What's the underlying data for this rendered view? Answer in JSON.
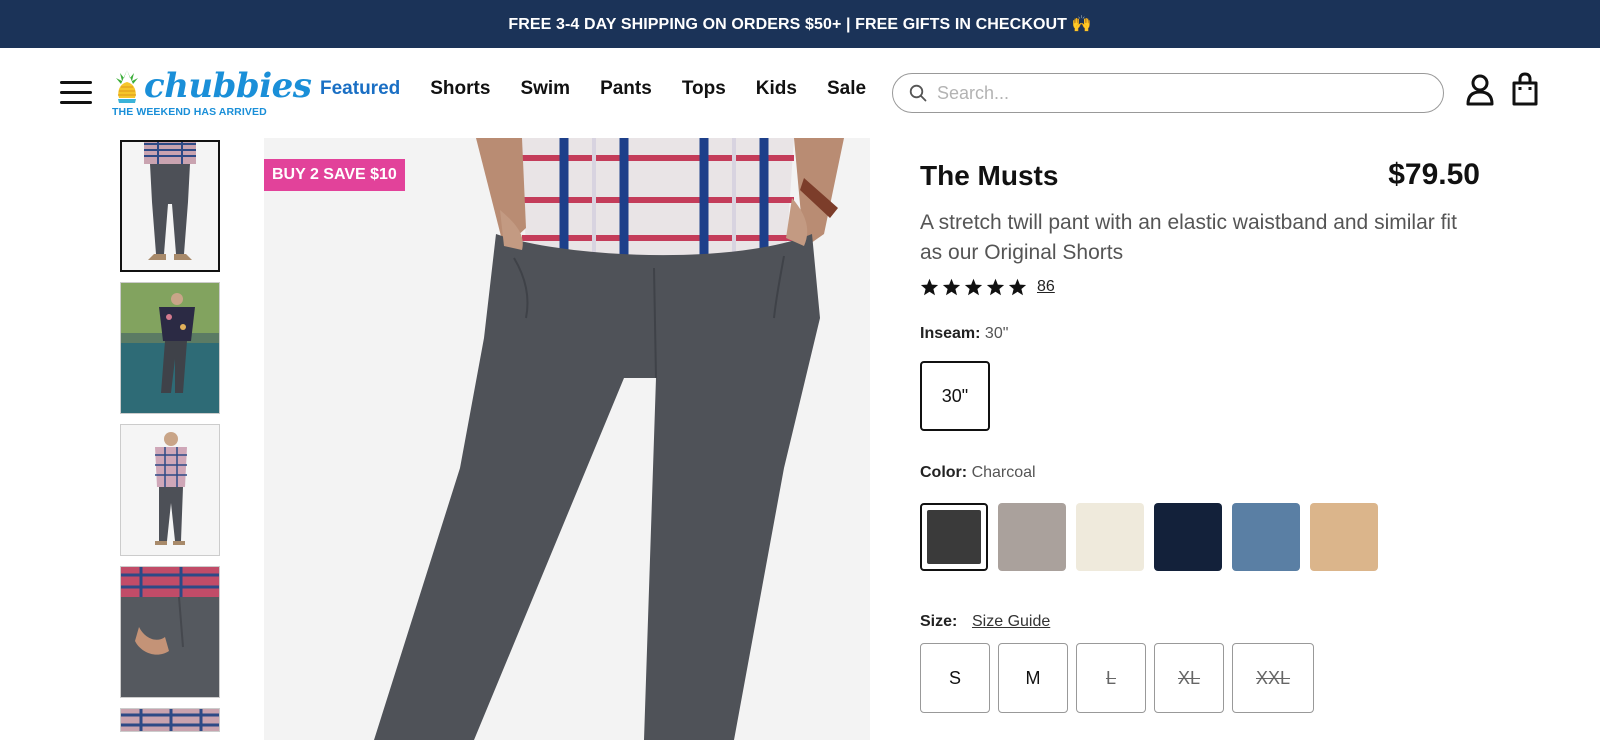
{
  "announcement": {
    "text": "FREE 3-4 DAY SHIPPING ON ORDERS $50+ | FREE GIFTS IN CHECKOUT 🙌"
  },
  "header": {
    "logo": {
      "word": "chubbies",
      "tagline": "THE WEEKEND HAS ARRIVED"
    },
    "nav": [
      {
        "label": "Featured",
        "active": true
      },
      {
        "label": "Shorts"
      },
      {
        "label": "Swim"
      },
      {
        "label": "Pants"
      },
      {
        "label": "Tops"
      },
      {
        "label": "Kids"
      },
      {
        "label": "Sale"
      }
    ],
    "search": {
      "placeholder": "Search..."
    }
  },
  "gallery": {
    "badge": "BUY 2 SAVE $10",
    "thumbnail_count": 5,
    "selected_index": 0
  },
  "product": {
    "title": "The Musts",
    "price": "$79.50",
    "description": "A stretch twill pant with an elastic waistband and similar fit as our Original Shorts",
    "rating": {
      "stars": 5,
      "review_count": "86"
    },
    "inseam": {
      "label": "Inseam:",
      "value": "30\"",
      "options": [
        {
          "label": "30\"",
          "selected": true
        }
      ]
    },
    "color": {
      "label": "Color:",
      "value": "Charcoal",
      "swatches": [
        {
          "name": "Charcoal",
          "hex": "#3a3a3a",
          "selected": true
        },
        {
          "name": "Taupe",
          "hex": "#aaa19c"
        },
        {
          "name": "Cream",
          "hex": "#efeadc"
        },
        {
          "name": "Navy",
          "hex": "#13213a"
        },
        {
          "name": "Slate Blue",
          "hex": "#5a7fa4"
        },
        {
          "name": "Khaki",
          "hex": "#dbb58b"
        }
      ]
    },
    "size": {
      "label": "Size:",
      "guide_label": "Size Guide",
      "options": [
        {
          "label": "S",
          "available": true
        },
        {
          "label": "M",
          "available": true
        },
        {
          "label": "L",
          "available": false
        },
        {
          "label": "XL",
          "available": false
        },
        {
          "label": "XXL",
          "available": false
        }
      ]
    }
  },
  "colors": {
    "brand_blue": "#1a8fd8",
    "nav_active": "#1a6fc4",
    "announce_bg": "#1b3358",
    "promo_pink": "#e2429a"
  }
}
